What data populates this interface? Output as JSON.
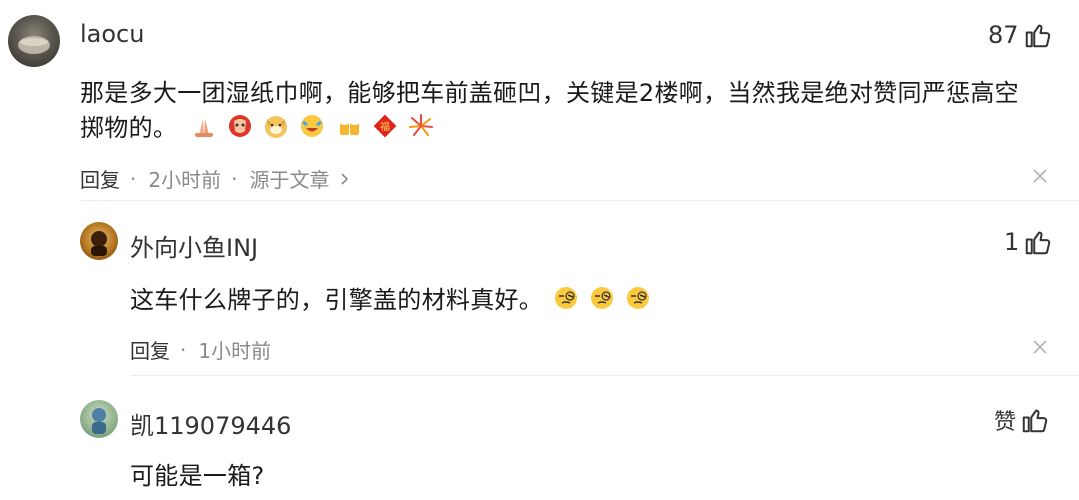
{
  "comments": [
    {
      "username": "laocu",
      "text_line1": "那是多大一团湿纸巾啊，能够把车前盖砸凹，关键是2楼啊，当然我是绝对赞同严惩高空",
      "text_line2": "掷物的。",
      "likes": "87",
      "reply_label": "回复",
      "time": "2小时前",
      "source": "源于文章",
      "emojis": [
        "pray-emoji",
        "moai-emoji",
        "doge-emoji",
        "cry-laugh-emoji",
        "beer-emoji",
        "fu-emoji",
        "firework-emoji"
      ]
    },
    {
      "username": "外向小鱼INJ",
      "text": "这车什么牌子的，引擎盖的材料真好。",
      "likes": "1",
      "reply_label": "回复",
      "time": "1小时前",
      "emojis": [
        "squint-emoji",
        "squint-emoji",
        "squint-emoji"
      ]
    },
    {
      "username": "凯119079446",
      "text": "可能是一箱?",
      "likes": "赞"
    }
  ],
  "icons": {
    "like": "thumbs-up-icon",
    "close": "close-icon",
    "chevron": "chevron-right-icon"
  }
}
